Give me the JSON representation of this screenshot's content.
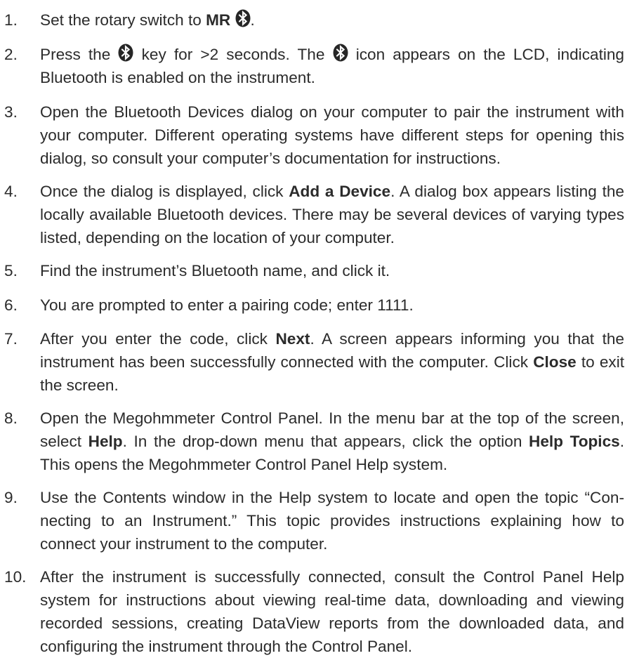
{
  "steps": [
    {
      "number": "1.",
      "parts": [
        {
          "t": "Set the rotary switch to "
        },
        {
          "b": "MR "
        },
        {
          "icon": "bluetooth-icon"
        },
        {
          "t": "."
        }
      ]
    },
    {
      "number": "2.",
      "parts": [
        {
          "t": "Press the "
        },
        {
          "icon": "bluetooth-icon"
        },
        {
          "t": " key for >2 seconds. The "
        },
        {
          "icon": "bluetooth-icon"
        },
        {
          "t": " icon appears on the LCD, indicating Bluetooth is enabled on the instrument."
        }
      ]
    },
    {
      "number": "3.",
      "parts": [
        {
          "t": "Open the Bluetooth Devices dialog on your computer to pair the instrument with your computer. Different operating systems have different steps for opening this dialog, so consult your computer’s documentation for instructions."
        }
      ]
    },
    {
      "number": "4.",
      "parts": [
        {
          "t": "Once the dialog is displayed, click "
        },
        {
          "b": "Add a Device"
        },
        {
          "t": ". A dialog box appears listing the locally available Bluetooth devices. There may be several devices of varying types listed, depending on the location of your computer."
        }
      ]
    },
    {
      "number": "5.",
      "parts": [
        {
          "t": "Find the instrument’s Bluetooth name, and click it."
        }
      ]
    },
    {
      "number": "6.",
      "parts": [
        {
          "t": "You are prompted to enter a pairing code; enter 1111."
        }
      ]
    },
    {
      "number": "7.",
      "parts": [
        {
          "t": "After you enter the code, click "
        },
        {
          "b": "Next"
        },
        {
          "t": ". A screen appears informing you that the instrument has been successfully connected with the computer. Click "
        },
        {
          "b": "Close"
        },
        {
          "t": " to exit the screen."
        }
      ]
    },
    {
      "number": "8.",
      "parts": [
        {
          "t": "Open the Megohmmeter Control Panel. In the menu bar at the top of the screen, select "
        },
        {
          "b": "Help"
        },
        {
          "t": ". In the drop-down menu that appears, click the option "
        },
        {
          "b": "Help Topics"
        },
        {
          "t": ". This opens the Megohmmeter Control Panel Help system."
        }
      ]
    },
    {
      "number": "9.",
      "parts": [
        {
          "t": "Use the Contents window in the Help system to locate and open the topic “Con-necting to an Instrument.” This topic provides instructions explaining how to connect your instrument to the computer."
        }
      ]
    },
    {
      "number": "10.",
      "parts": [
        {
          "t": "After the instrument is successfully connected, consult the Control Panel Help system for instructions about viewing real-time data, downloading and viewing recorded sessions, creating DataView reports from the downloaded data, and configuring the instrument through the Control Panel."
        }
      ]
    }
  ]
}
